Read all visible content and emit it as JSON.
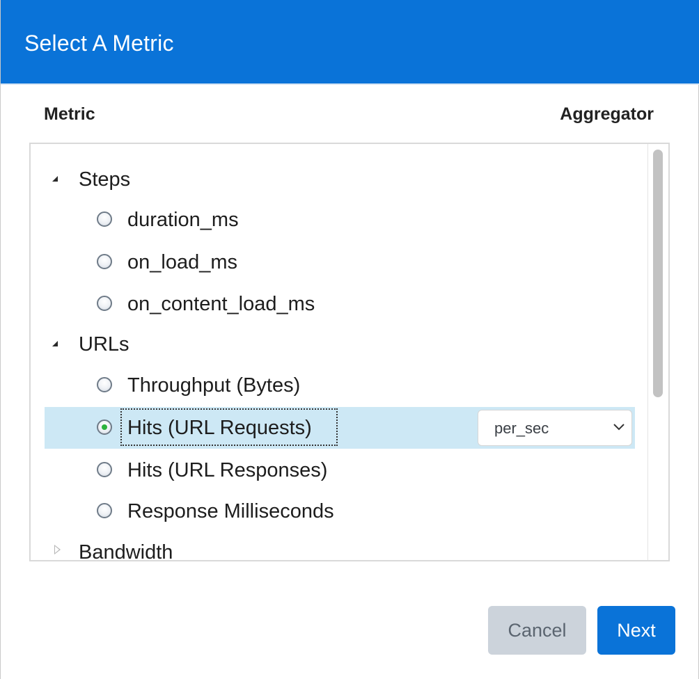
{
  "dialog": {
    "title": "Select A Metric",
    "colors": {
      "header_bg": "#0a73d8",
      "selected_row_bg": "#cde8f5",
      "cancel_bg": "#ccd3db",
      "next_bg": "#0a73d8",
      "radio_checked": "#2db33d"
    }
  },
  "columns": {
    "metric": "Metric",
    "aggregator": "Aggregator"
  },
  "tree": {
    "groups": [
      {
        "label": "Steps",
        "expanded": true,
        "items": [
          {
            "label": "duration_ms",
            "checked": false
          },
          {
            "label": "on_load_ms",
            "checked": false
          },
          {
            "label": "on_content_load_ms",
            "checked": false
          }
        ]
      },
      {
        "label": "URLs",
        "expanded": true,
        "items": [
          {
            "label": "Throughput (Bytes)",
            "checked": false
          },
          {
            "label": "Hits (URL Requests)",
            "checked": true,
            "aggregator": "per_sec"
          },
          {
            "label": "Hits (URL Responses)",
            "checked": false
          },
          {
            "label": "Response Milliseconds",
            "checked": false
          }
        ]
      },
      {
        "label": "Bandwidth",
        "expanded": false,
        "items": []
      }
    ]
  },
  "buttons": {
    "cancel": "Cancel",
    "next": "Next"
  },
  "icons": {
    "expanded": "triangle-down-icon",
    "collapsed": "triangle-right-icon",
    "select_arrow": "chevron-down-icon"
  }
}
